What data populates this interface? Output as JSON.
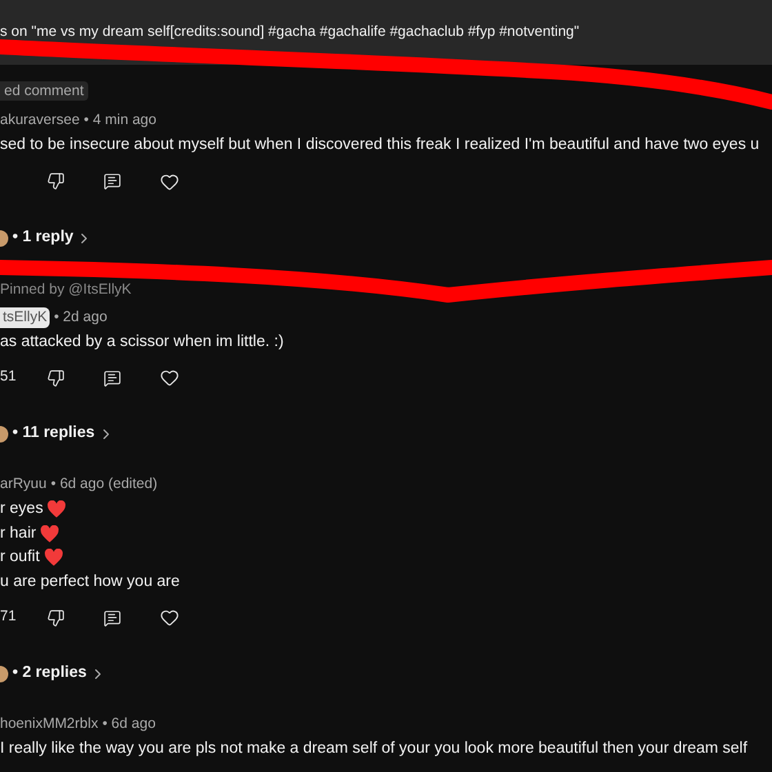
{
  "header": {
    "title": "s on \"me vs my dream self[credits:sound] #gacha #gachalife #gachaclub #fyp #notventing\""
  },
  "comments": [
    {
      "badge": "ed comment",
      "author": "akuraversee",
      "author_highlighted": false,
      "time": "• 4 min ago",
      "lines": [
        {
          "text": "sed to be insecure about myself but when I discovered this freak I realized I'm beautiful and have two eyes u",
          "heart": false
        }
      ],
      "replies": "• 1 reply"
    },
    {
      "pinned_by": "Pinned by @ItsEllyK",
      "author": "tsEllyK",
      "author_highlighted": true,
      "time": "• 2d ago",
      "lines": [
        {
          "text": "as attacked by a scissor when im little. :)",
          "heart": false
        }
      ],
      "likes": "51",
      "replies": "• 11 replies"
    },
    {
      "author": "arRyuu",
      "author_highlighted": false,
      "time": "• 6d ago (edited)",
      "lines": [
        {
          "text": "r eyes",
          "heart": true
        },
        {
          "text": "r hair",
          "heart": true
        },
        {
          "text": "r oufit",
          "heart": true
        },
        {
          "text": "u are perfect how you are",
          "heart": false
        }
      ],
      "likes": "71",
      "replies": "• 2 replies"
    },
    {
      "author": "hoenixMM2rblx",
      "author_highlighted": false,
      "time": "• 6d ago",
      "lines": [
        {
          "text": "I really like the way you are pls not make a dream self of your you look more beautiful then your dream self",
          "heart": false
        }
      ]
    }
  ]
}
